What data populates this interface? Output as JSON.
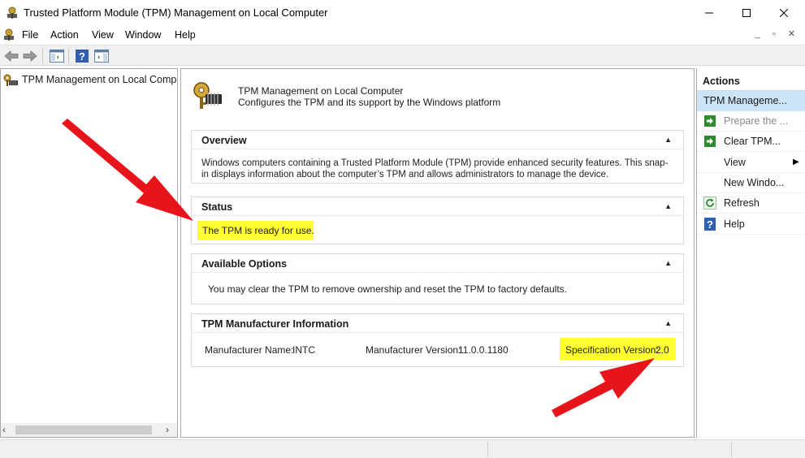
{
  "window": {
    "title": "Trusted Platform Module (TPM) Management on Local Computer",
    "minimize": "—",
    "maximize": "☐",
    "close": "✕"
  },
  "menu": {
    "items": [
      "File",
      "Action",
      "View",
      "Window",
      "Help"
    ],
    "mdi_buttons": "_ ▫ ✕"
  },
  "toolbar": {
    "icons": [
      "back-icon",
      "forward-icon",
      "show-hide-tree-icon",
      "help-icon",
      "show-hide-action-pane-icon"
    ]
  },
  "tree": {
    "root_label": "TPM Management on Local Compu",
    "scroll_left": "‹",
    "scroll_right": "›"
  },
  "header": {
    "title": "TPM Management on Local Computer",
    "description": "Configures the TPM and its support by the Windows platform"
  },
  "sections": {
    "overview": {
      "title": "Overview",
      "text": "Windows computers containing a Trusted Platform Module (TPM) provide enhanced security features. This snap-in displays information about the computer’s TPM and allows administrators to manage the device."
    },
    "status": {
      "title": "Status",
      "text": "The TPM is ready for use."
    },
    "options": {
      "title": "Available Options",
      "text": "You may clear the TPM to remove ownership and reset the TPM to factory defaults."
    },
    "manufacturer": {
      "title": "TPM Manufacturer Information",
      "name_label": "Manufacturer Name:",
      "name_value": "INTC",
      "version_label": "Manufacturer Version:",
      "version_value": "11.0.0.1180",
      "spec_label": "Specification Version:",
      "spec_value": "2.0"
    },
    "caret": "▲"
  },
  "actions": {
    "title": "Actions",
    "group": "TPM Manageme...",
    "items": [
      {
        "label": "Prepare the ...",
        "icon": "green-arrow-icon",
        "disabled": true
      },
      {
        "label": "Clear TPM...",
        "icon": "green-arrow-icon",
        "disabled": false
      },
      {
        "label": "View",
        "icon": "",
        "disabled": false,
        "submenu": "▶"
      },
      {
        "label": "New Windo...",
        "icon": "",
        "disabled": false
      },
      {
        "label": "Refresh",
        "icon": "refresh-icon",
        "disabled": false
      },
      {
        "label": "Help",
        "icon": "help-icon",
        "disabled": false
      }
    ]
  },
  "colors": {
    "highlight": "#ffff33",
    "arrow_red": "#e8141b",
    "selection": "#cce4f7"
  }
}
